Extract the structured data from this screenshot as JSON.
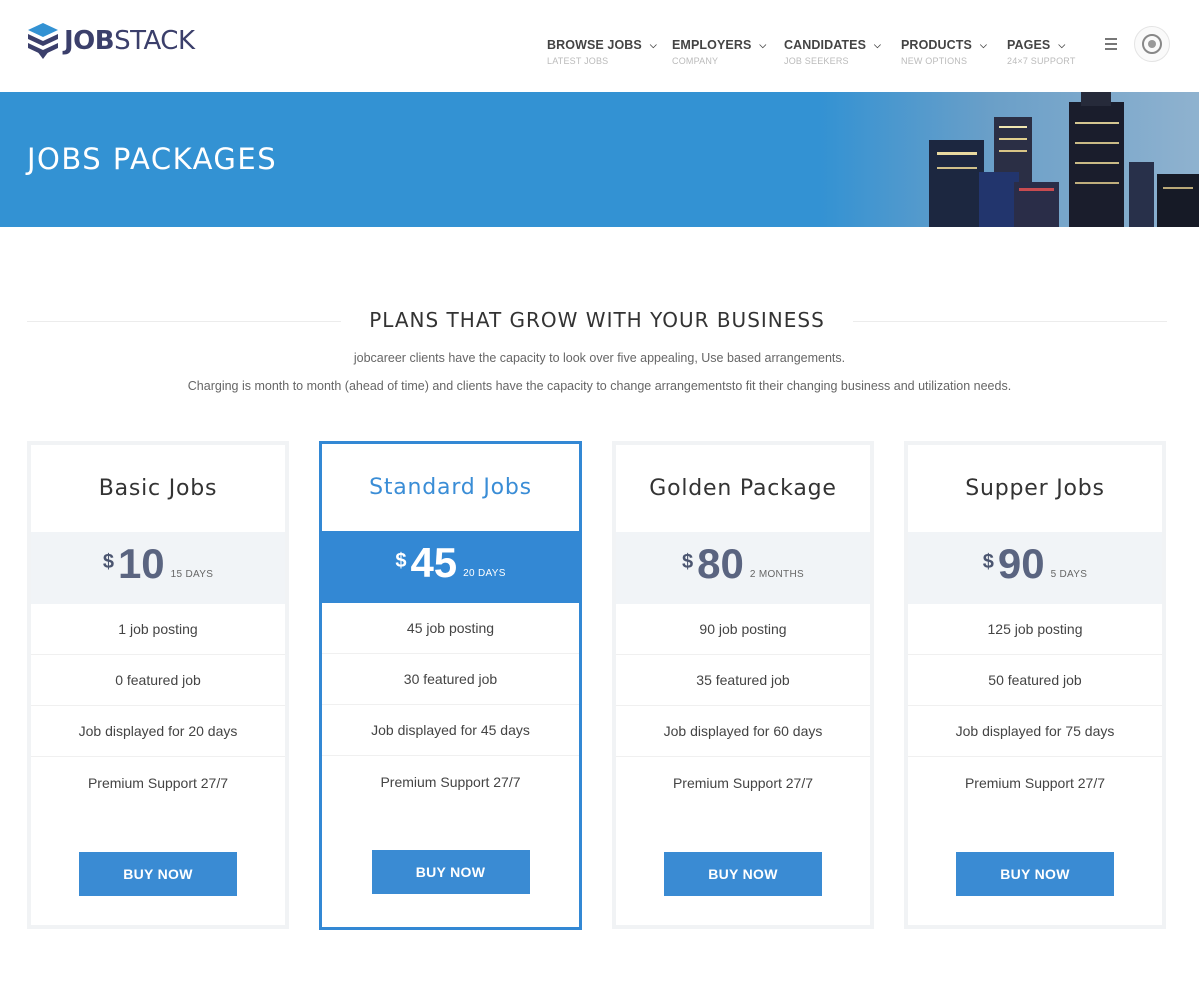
{
  "brand": {
    "name_bold": "JOB",
    "name_light": "STACK",
    "icon": "stacked-layers-logo-icon",
    "accent_color": "#3392d3"
  },
  "nav": [
    {
      "label": "BROWSE JOBS",
      "sub": "LATEST JOBS"
    },
    {
      "label": "EMPLOYERS",
      "sub": "COMPANY"
    },
    {
      "label": "CANDIDATES",
      "sub": "JOB SEEKERS"
    },
    {
      "label": "PRODUCTS",
      "sub": "NEW OPTIONS"
    },
    {
      "label": "PAGES",
      "sub": "24×7 SUPPORT"
    }
  ],
  "banner": {
    "title": "JOBS PACKAGES"
  },
  "section": {
    "title": "PLANS THAT GROW WITH YOUR BUSINESS",
    "desc1": "jobcareer clients have the capacity to look over five appealing, Use based arrangements.",
    "desc2": "Charging is month to month (ahead of time) and clients have the capacity to change arrangementsto fit their changing business and utilization needs."
  },
  "plans": [
    {
      "title": "Basic Jobs",
      "currency": "$",
      "amount": "10",
      "period": "15 DAYS",
      "features": [
        "1 job posting",
        "0 featured job",
        "Job displayed for 20 days",
        "Premium Support 27/7"
      ],
      "button": "BUY NOW"
    },
    {
      "title": "Standard Jobs",
      "currency": "$",
      "amount": "45",
      "period": "20 DAYS",
      "features": [
        "45 job posting",
        "30 featured job",
        "Job displayed for 45 days",
        "Premium Support 27/7"
      ],
      "button": "BUY NOW"
    },
    {
      "title": "Golden Package",
      "currency": "$",
      "amount": "80",
      "period": "2 MONTHS",
      "features": [
        "90 job posting",
        "35 featured job",
        "Job displayed for 60 days",
        "Premium Support 27/7"
      ],
      "button": "BUY NOW"
    },
    {
      "title": "Supper Jobs",
      "currency": "$",
      "amount": "90",
      "period": "5 DAYS",
      "features": [
        "125 job posting",
        "50 featured job",
        "Job displayed for 75 days",
        "Premium Support 27/7"
      ],
      "button": "BUY NOW"
    }
  ]
}
